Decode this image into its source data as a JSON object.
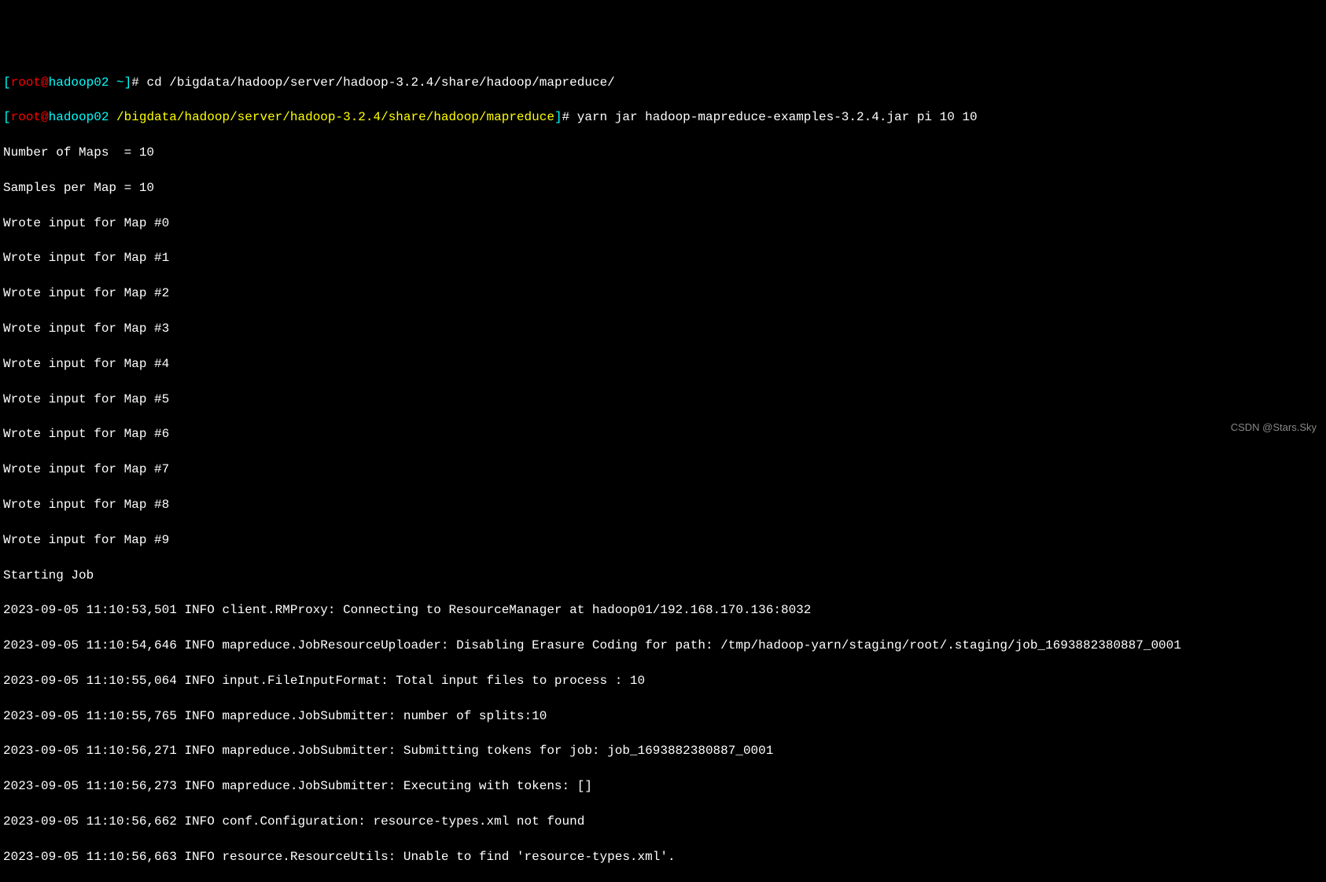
{
  "prompts": [
    {
      "user": "root",
      "host": "hadoop02",
      "path": "~",
      "path_class": "path-home",
      "command": "cd /bigdata/hadoop/server/hadoop-3.2.4/share/hadoop/mapreduce/"
    },
    {
      "user": "root",
      "host": "hadoop02",
      "path": "/bigdata/hadoop/server/hadoop-3.2.4/share/hadoop/mapreduce",
      "path_class": "path-dir",
      "command": "yarn jar hadoop-mapreduce-examples-3.2.4.jar pi 10 10"
    }
  ],
  "output_lines": [
    "Number of Maps  = 10",
    "Samples per Map = 10",
    "Wrote input for Map #0",
    "Wrote input for Map #1",
    "Wrote input for Map #2",
    "Wrote input for Map #3",
    "Wrote input for Map #4",
    "Wrote input for Map #5",
    "Wrote input for Map #6",
    "Wrote input for Map #7",
    "Wrote input for Map #8",
    "Wrote input for Map #9",
    "Starting Job",
    "2023-09-05 11:10:53,501 INFO client.RMProxy: Connecting to ResourceManager at hadoop01/192.168.170.136:8032",
    "2023-09-05 11:10:54,646 INFO mapreduce.JobResourceUploader: Disabling Erasure Coding for path: /tmp/hadoop-yarn/staging/root/.staging/job_1693882380887_0001",
    "2023-09-05 11:10:55,064 INFO input.FileInputFormat: Total input files to process : 10",
    "2023-09-05 11:10:55,765 INFO mapreduce.JobSubmitter: number of splits:10",
    "2023-09-05 11:10:56,271 INFO mapreduce.JobSubmitter: Submitting tokens for job: job_1693882380887_0001",
    "2023-09-05 11:10:56,273 INFO mapreduce.JobSubmitter: Executing with tokens: []",
    "2023-09-05 11:10:56,662 INFO conf.Configuration: resource-types.xml not found",
    "2023-09-05 11:10:56,663 INFO resource.ResourceUtils: Unable to find 'resource-types.xml'."
  ],
  "watermark": "CSDN @Stars.Sky"
}
